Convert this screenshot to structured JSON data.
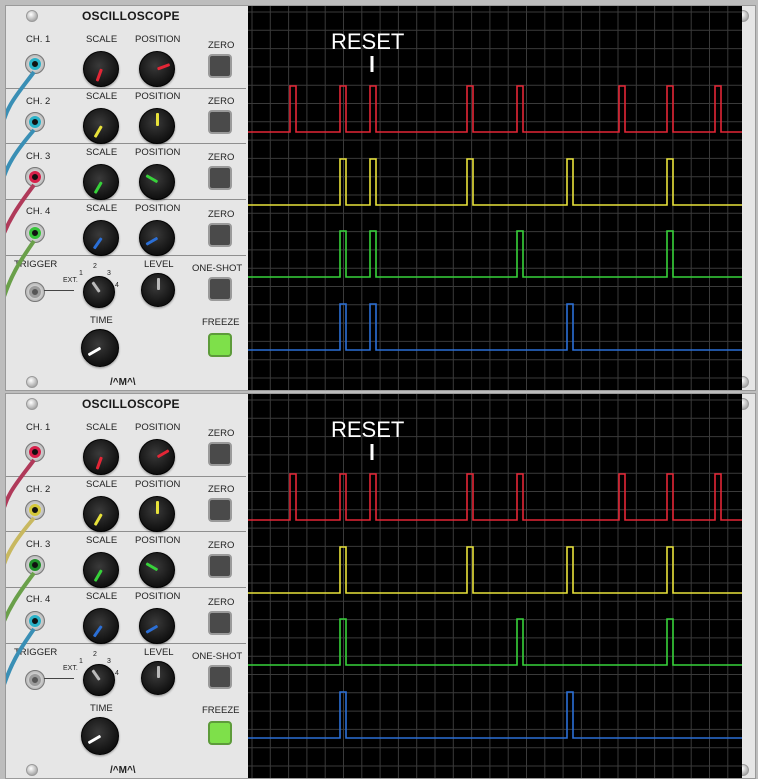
{
  "modules": [
    {
      "title": "OSCILLOSCOPE",
      "reset_label": "RESET",
      "logo": "/^M^\\",
      "channels": [
        {
          "label": "CH. 1",
          "scale_label": "SCALE",
          "position_label": "POSITION",
          "zero_label": "ZERO",
          "color": "#e32636",
          "jack_color": "#2ab2c8"
        },
        {
          "label": "CH. 2",
          "scale_label": "SCALE",
          "position_label": "POSITION",
          "zero_label": "ZERO",
          "color": "#e8e23a",
          "jack_color": "#2ab2c8"
        },
        {
          "label": "CH. 3",
          "scale_label": "SCALE",
          "position_label": "POSITION",
          "zero_label": "ZERO",
          "color": "#37d23a",
          "jack_color": "#d6204a"
        },
        {
          "label": "CH. 4",
          "scale_label": "SCALE",
          "position_label": "POSITION",
          "zero_label": "ZERO",
          "color": "#2b6fd6",
          "jack_color": "#37c43a"
        }
      ],
      "trigger": {
        "label": "TRIGGER",
        "ext": "EXT.",
        "positions": [
          "1",
          "2",
          "3",
          "4"
        ],
        "level_label": "LEVEL",
        "oneshot_label": "ONE-SHOT"
      },
      "time_label": "TIME",
      "freeze_label": "FREEZE",
      "freeze_on": true
    },
    {
      "title": "OSCILLOSCOPE",
      "reset_label": "RESET",
      "logo": "/^M^\\",
      "channels": [
        {
          "label": "CH. 1",
          "scale_label": "SCALE",
          "position_label": "POSITION",
          "zero_label": "ZERO",
          "color": "#e32636",
          "jack_color": "#d6204a"
        },
        {
          "label": "CH. 2",
          "scale_label": "SCALE",
          "position_label": "POSITION",
          "zero_label": "ZERO",
          "color": "#e8e23a",
          "jack_color": "#d4c83a"
        },
        {
          "label": "CH. 3",
          "scale_label": "SCALE",
          "position_label": "POSITION",
          "zero_label": "ZERO",
          "color": "#37d23a",
          "jack_color": "#1f8f2a"
        },
        {
          "label": "CH. 4",
          "scale_label": "SCALE",
          "position_label": "POSITION",
          "zero_label": "ZERO",
          "color": "#2b6fd6",
          "jack_color": "#2ab2c8"
        }
      ],
      "trigger": {
        "label": "TRIGGER",
        "ext": "EXT.",
        "positions": [
          "1",
          "2",
          "3",
          "4"
        ],
        "level_label": "LEVEL",
        "oneshot_label": "ONE-SHOT"
      },
      "time_label": "TIME",
      "freeze_label": "FREEZE",
      "freeze_on": true
    }
  ]
}
